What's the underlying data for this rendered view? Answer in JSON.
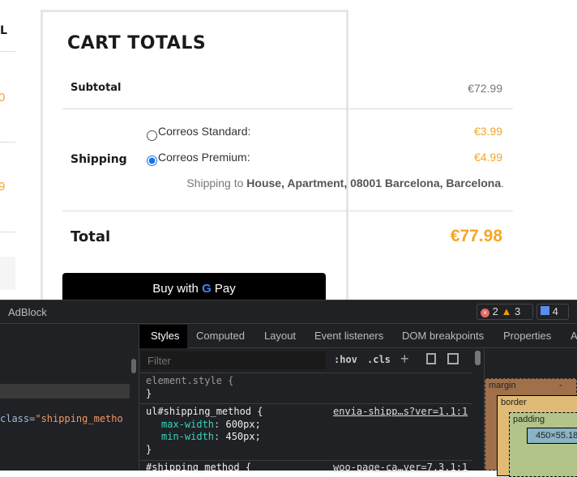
{
  "left_column": {
    "header_fragment": "L",
    "value1_fragment": "0",
    "value2_fragment": "9"
  },
  "cart": {
    "title": "CART TOTALS",
    "subtotal_label": "Subtotal",
    "subtotal_value": "€72.99",
    "shipping_label": "Shipping",
    "options": [
      {
        "label": "Correos Standard:",
        "price": "€3.99",
        "selected": false
      },
      {
        "label": "Correos Premium:",
        "price": "€4.99",
        "selected": true
      }
    ],
    "shipping_to_prefix": "Shipping to ",
    "shipping_to_address": "House, Apartment, 08001 Barcelona, Barcelona",
    "shipping_to_suffix": ".",
    "total_label": "Total",
    "total_value": "€77.98",
    "gpay_label": "Buy with",
    "gpay_pay": "Pay"
  },
  "devtools": {
    "panel_label": "AdBlock",
    "errors": "2",
    "warnings": "3",
    "messages": "4",
    "tabs": [
      "Styles",
      "Computed",
      "Layout",
      "Event listeners",
      "DOM breakpoints",
      "Properties",
      "A"
    ],
    "filter_placeholder": "Filter",
    "hov": ":hov",
    "cls": ".cls",
    "dom_fragment_attr": "class=",
    "dom_fragment_value": "\"shipping_metho",
    "rules": [
      {
        "selector": "element.style {",
        "close": "}"
      },
      {
        "selector": "ul#shipping_method {",
        "source": "envia-shipp…s?ver=1.1:1",
        "props": [
          {
            "name": "max-width",
            "value": "600px;"
          },
          {
            "name": "min-width",
            "value": "450px;"
          }
        ],
        "close": "}"
      },
      {
        "selector": "#shipping_method {",
        "source": "woo-page-ca…ver=7.3.1:1"
      }
    ],
    "box_model": {
      "margin": "margin",
      "border": "border",
      "padding": "padding",
      "dash": "-",
      "content": "450×55.18"
    }
  }
}
